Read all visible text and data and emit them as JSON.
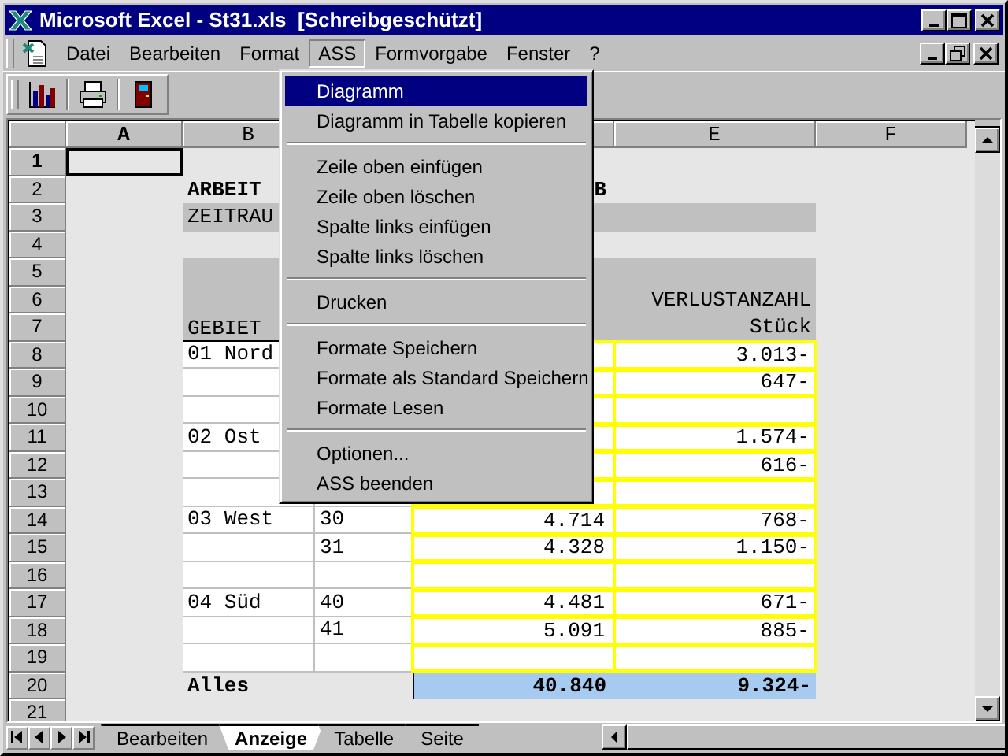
{
  "window": {
    "title": "Microsoft Excel - St31.xls  [Schreibgeschützt]"
  },
  "menu_bar": [
    {
      "label": "Datei",
      "selected": false
    },
    {
      "label": "Bearbeiten",
      "selected": false
    },
    {
      "label": "Format",
      "selected": false
    },
    {
      "label": "ASS",
      "selected": true
    },
    {
      "label": "Formvorgabe",
      "selected": false
    },
    {
      "label": "Fenster",
      "selected": false
    },
    {
      "label": "?",
      "selected": false
    }
  ],
  "open_menu": {
    "items": [
      {
        "kind": "item",
        "label": "Diagramm",
        "selected": true
      },
      {
        "kind": "item",
        "label": "Diagramm in Tabelle kopieren",
        "selected": false
      },
      {
        "kind": "separator"
      },
      {
        "kind": "item",
        "label": "Zeile oben einfügen",
        "selected": false
      },
      {
        "kind": "item",
        "label": "Zeile oben löschen",
        "selected": false
      },
      {
        "kind": "item",
        "label": "Spalte links einfügen",
        "selected": false
      },
      {
        "kind": "item",
        "label": "Spalte links löschen",
        "selected": false
      },
      {
        "kind": "separator"
      },
      {
        "kind": "item",
        "label": "Drucken",
        "selected": false
      },
      {
        "kind": "separator"
      },
      {
        "kind": "item",
        "label": "Formate Speichern",
        "selected": false
      },
      {
        "kind": "item",
        "label": "Formate als Standard Speichern",
        "selected": false
      },
      {
        "kind": "item",
        "label": "Formate Lesen",
        "selected": false
      },
      {
        "kind": "separator"
      },
      {
        "kind": "item",
        "label": "Optionen...",
        "selected": false
      },
      {
        "kind": "item",
        "label": "ASS beenden",
        "selected": false
      }
    ]
  },
  "sheet": {
    "columns": [
      {
        "label": "A",
        "selected": true
      },
      {
        "label": "B",
        "selected": false
      },
      {
        "label": "E",
        "selected": false
      },
      {
        "label": "F",
        "selected": false
      }
    ],
    "rows": [
      {
        "number": "1",
        "kind": "blank",
        "selected": true
      },
      {
        "number": "2",
        "kind": "title",
        "selected": false,
        "b": "ARBEIT",
        "d": "B"
      },
      {
        "number": "3",
        "kind": "band",
        "selected": false,
        "b": "ZEITRAU"
      },
      {
        "number": "4",
        "kind": "blank",
        "selected": false
      },
      {
        "number": "5",
        "kind": "band",
        "selected": false
      },
      {
        "number": "6",
        "kind": "band",
        "selected": false,
        "e": "VERLUSTANZAHL"
      },
      {
        "number": "7",
        "kind": "header",
        "selected": false,
        "b": "GEBIET",
        "e": "Stück"
      },
      {
        "number": "8",
        "kind": "data",
        "selected": false,
        "b": "01 Nord",
        "e": "3.013-"
      },
      {
        "number": "9",
        "kind": "data",
        "selected": false,
        "e": "647-"
      },
      {
        "number": "10",
        "kind": "data",
        "selected": false
      },
      {
        "number": "11",
        "kind": "data",
        "selected": false,
        "b": "02 Ost",
        "e": "1.574-"
      },
      {
        "number": "12",
        "kind": "data",
        "selected": false,
        "e": "616-"
      },
      {
        "number": "13",
        "kind": "data",
        "selected": false
      },
      {
        "number": "14",
        "kind": "data",
        "selected": false,
        "b": "03 West",
        "c": "30",
        "d": "4.714",
        "e": "768-"
      },
      {
        "number": "15",
        "kind": "data",
        "selected": false,
        "c": "31",
        "d": "4.328",
        "e": "1.150-"
      },
      {
        "number": "16",
        "kind": "data",
        "selected": false
      },
      {
        "number": "17",
        "kind": "data",
        "selected": false,
        "b": "04 Süd",
        "c": "40",
        "d": "4.481",
        "e": "671-"
      },
      {
        "number": "18",
        "kind": "data",
        "selected": false,
        "c": "41",
        "d": "5.091",
        "e": "885-"
      },
      {
        "number": "19",
        "kind": "data",
        "selected": false
      },
      {
        "number": "20",
        "kind": "total",
        "selected": false,
        "b": "Alles",
        "d": "40.840",
        "e": "9.324-"
      },
      {
        "number": "21",
        "kind": "blank",
        "selected": false
      }
    ]
  },
  "sheet_tabs": [
    {
      "label": "Bearbeiten",
      "selected": false
    },
    {
      "label": "Anzeige",
      "selected": true
    },
    {
      "label": "Tabelle",
      "selected": false
    },
    {
      "label": "Seite",
      "selected": false
    }
  ]
}
